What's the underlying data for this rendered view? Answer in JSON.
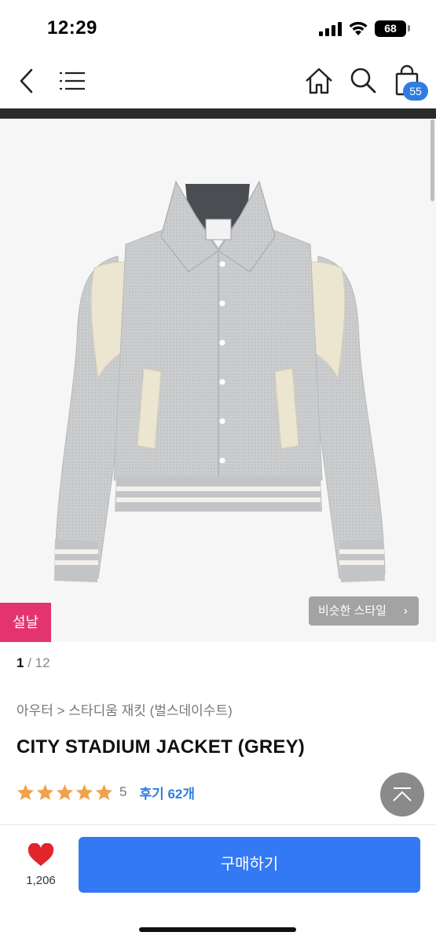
{
  "status_bar": {
    "time": "12:29",
    "battery": "68",
    "icons": [
      "signal-icon",
      "wifi-icon",
      "battery-icon"
    ]
  },
  "nav": {
    "icons": [
      "chevron-left-icon",
      "menu-icon",
      "home-icon",
      "search-icon",
      "shopping-bag-icon"
    ],
    "cart_count": "55"
  },
  "gallery": {
    "current": "1",
    "separator": "/",
    "total": "12",
    "promo_tag": "설날",
    "similar_style_label": "비슷한 스타일",
    "similar_style_chevron": "›"
  },
  "product": {
    "breadcrumb": "아우터 > 스타디움 재킷 (벌스데이수트)",
    "title": "CITY STADIUM JACKET (GREY)",
    "rating_score": "5",
    "stars_filled": 5,
    "review_link": "후기 62개"
  },
  "bottom_bar": {
    "like_count": "1,206",
    "buy_label": "구매하기"
  },
  "colors": {
    "accent_blue": "#3379f3",
    "promo_pink": "#e4346f",
    "star_orange": "#f0a14a",
    "heart_red": "#e0262b"
  }
}
